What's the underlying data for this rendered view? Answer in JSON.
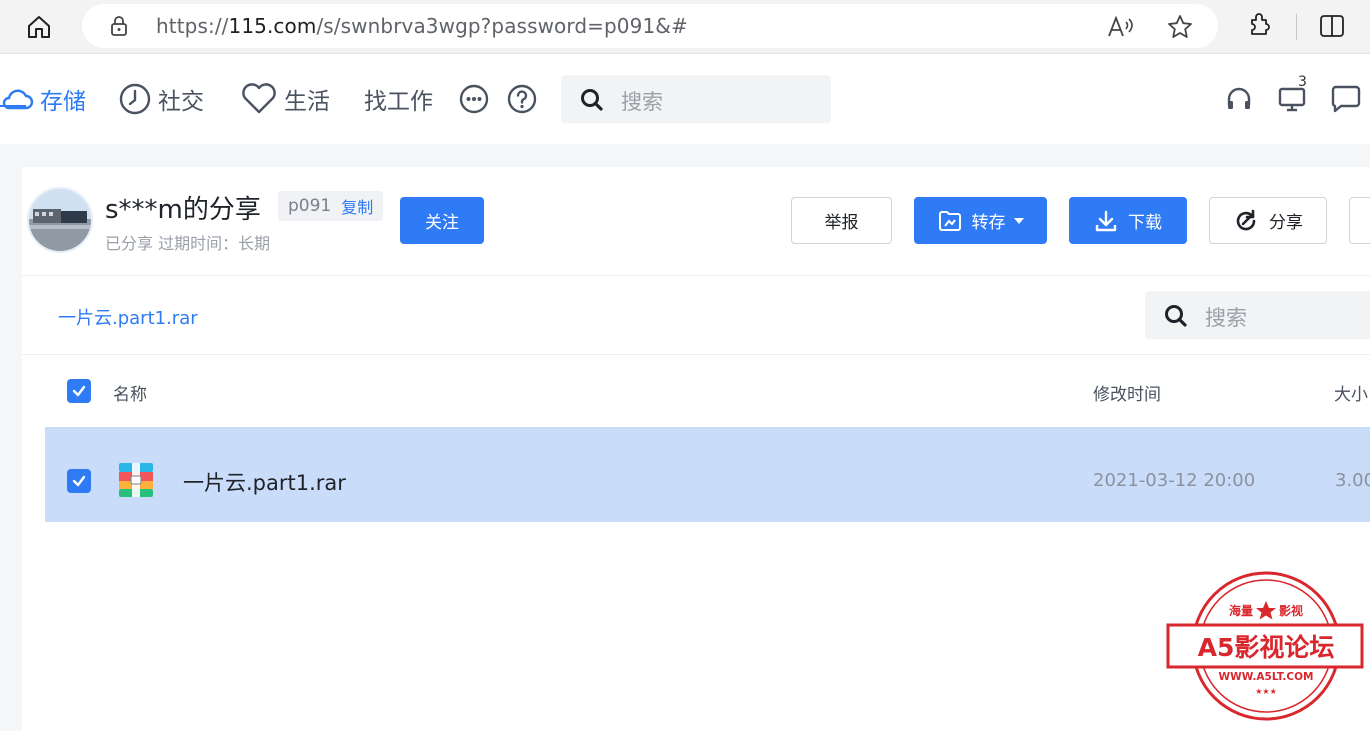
{
  "browser": {
    "url_prefix": "https://",
    "url_host": "115.com",
    "url_path": "/s/swnbrva3wgp?password=p091&#"
  },
  "nav": {
    "storage": "存储",
    "social": "社交",
    "life": "生活",
    "job": "找工作",
    "search_placeholder": "搜索",
    "monitor_badge": "3"
  },
  "share": {
    "title": "s***m的分享",
    "code": "p091",
    "copy": "复制",
    "subtitle": "已分享 过期时间：长期",
    "follow": "关注",
    "report": "举报",
    "save": "转存",
    "download": "下载",
    "share_btn": "分享"
  },
  "breadcrumb": "一片云.part1.rar",
  "file_search_placeholder": "搜索",
  "table": {
    "col_name": "名称",
    "col_time": "修改时间",
    "col_size": "大小",
    "rows": [
      {
        "name": "一片云.part1.rar",
        "time": "2021-03-12 20:00",
        "size": "3.00"
      }
    ]
  },
  "watermark": {
    "top_left": "海量",
    "top_right": "影视",
    "main": "A5影视论坛",
    "url": "WWW.A5LT.COM"
  },
  "colors": {
    "accent": "#2f7bf5",
    "selected_row": "#c9ddfb",
    "stamp_red": "#d9272e"
  }
}
